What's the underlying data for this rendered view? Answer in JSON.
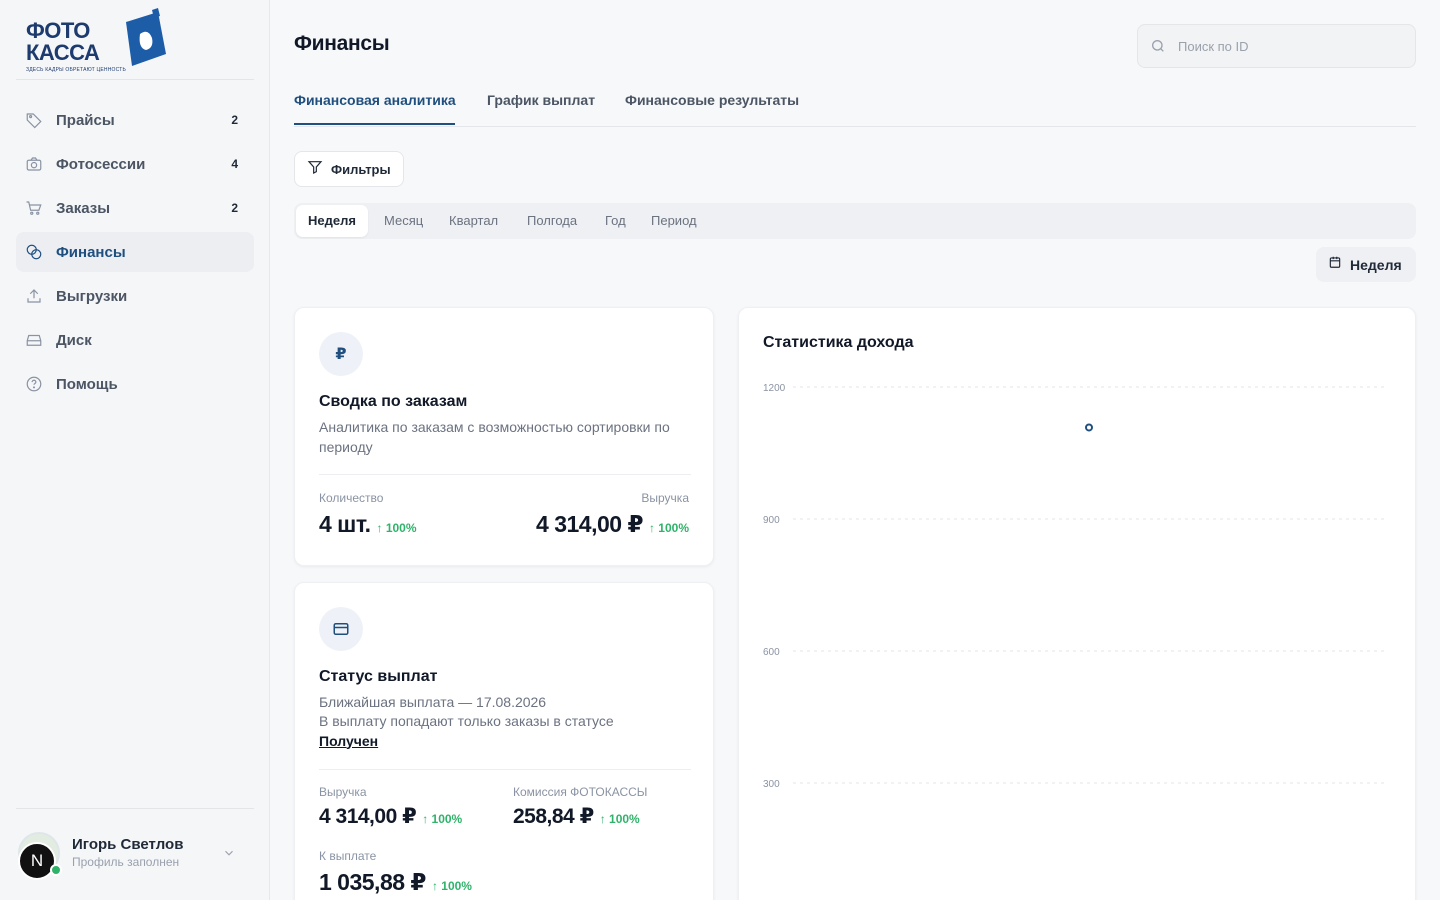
{
  "brand": {
    "logo_line1": "ФОТО",
    "logo_line2": "КАССА",
    "tagline": "ЗДЕСЬ КАДРЫ ОБРЕТАЮТ ЦЕННОСТЬ",
    "accent": "#1f4f7f"
  },
  "sidebar": {
    "items": [
      {
        "label": "Прайсы",
        "badge": "2",
        "icon": "tag-icon"
      },
      {
        "label": "Фотосессии",
        "badge": "4",
        "icon": "camera-icon"
      },
      {
        "label": "Заказы",
        "badge": "2",
        "icon": "cart-icon"
      },
      {
        "label": "Финансы",
        "badge": "",
        "icon": "coins-icon",
        "active": true
      },
      {
        "label": "Выгрузки",
        "badge": "",
        "icon": "upload-icon"
      },
      {
        "label": "Диск",
        "badge": "",
        "icon": "disk-icon"
      },
      {
        "label": "Помощь",
        "badge": "",
        "icon": "help-icon"
      }
    ]
  },
  "profile": {
    "name": "Игорь Светлов",
    "status": "Профиль заполнен",
    "initial": "N"
  },
  "header": {
    "title": "Финансы",
    "search_placeholder": "Поиск по ID"
  },
  "tabs": [
    {
      "label": "Финансовая аналитика",
      "active": true
    },
    {
      "label": "График выплат"
    },
    {
      "label": "Финансовые результаты"
    }
  ],
  "filters_label": "Фильтры",
  "periods": [
    "Неделя",
    "Месяц",
    "Квартал",
    "Полгода",
    "Год",
    "Период"
  ],
  "period_selected": "Неделя",
  "date_range_label": "Неделя",
  "orders_card": {
    "icon_glyph": "₽",
    "title": "Сводка по заказам",
    "desc": "Аналитика по заказам с возможностью сортировки по периоду",
    "count_label": "Количество",
    "count_value": "4 шт.",
    "count_delta": "↑ 100%",
    "revenue_label": "Выручка",
    "revenue_value": "4 314,00 ₽",
    "revenue_delta": "↑ 100%"
  },
  "payout_card": {
    "title": "Статус выплат",
    "next_payout": "Ближайшая выплата — 17.08.2026",
    "note": "В выплату попадают только заказы в статусе",
    "status_link": "Получен",
    "revenue_label": "Выручка",
    "revenue_value": "4 314,00 ₽",
    "revenue_delta": "↑ 100%",
    "commission_label": "Комиссия ФОТОКАССЫ",
    "commission_value": "258,84 ₽",
    "commission_delta": "↑ 100%",
    "payout_label": "К выплате",
    "payout_value": "1 035,88 ₽",
    "payout_delta": "↑ 100%"
  },
  "chart_data": {
    "type": "line",
    "title": "Статистика дохода",
    "yticks": [
      1200,
      900,
      600,
      300
    ],
    "ylim": [
      0,
      1200
    ],
    "grid": true,
    "series": [
      {
        "points": [
          {
            "x": 0.5,
            "y": 1108
          }
        ]
      }
    ],
    "point_color": "#1f4f7f"
  }
}
